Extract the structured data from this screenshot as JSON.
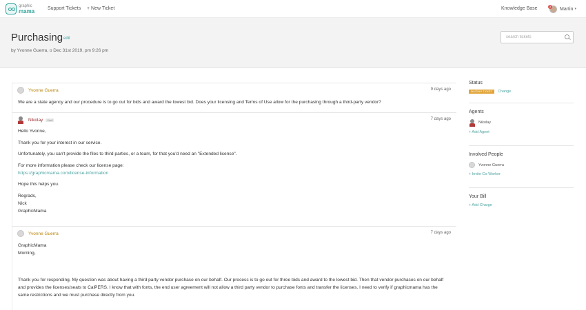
{
  "logo": {
    "line1": "graphic",
    "line2": "mama"
  },
  "nav": {
    "support_tickets": "Support Tickets",
    "new_ticket": "+ New Ticket",
    "knowledge_base": "Knowledge Base",
    "user_name": "Martin",
    "notification_count": "3"
  },
  "header": {
    "title": "Purchasing",
    "edit_label": "edit",
    "byline": "by Yvonne Guerra, o Dec 31st 2019, pm 9:26 pm",
    "search_placeholder": "search tickets"
  },
  "messages": [
    {
      "author": "Yvonne Guerra",
      "time": "9 days ago",
      "body": [
        "We are a state agency and our procedure is to go out for bids and award the lowest bid. Does your licensing and Terms of Use allow for the purchasing through a third-party vendor?"
      ]
    },
    {
      "author": "Nikolay",
      "staff_tag": "Staff",
      "time": "7 days ago",
      "greeting": "Hello Yvonne,",
      "p1": "Thank you for your interest in our service.",
      "p2": "Unfortunately, you can't provide the files to third parties, or a team, for that you'd need an \"Extended license\".",
      "p3": "For more information please check our license page:",
      "link": "https://graphicmama.com/license-information",
      "p4": "Hope this helps you.",
      "sign1": "Regrads,",
      "sign2": "Nick",
      "sign3": "GraphicMama"
    },
    {
      "author": "Yvonne Guerra",
      "time": "7 days ago",
      "line1": "GraphicMama",
      "line2": "Morning,",
      "p1": "Thank you for responding. My question was about having a third party vendor purchase on our behalf. Our process is to go out for three bids and award to the lowest bid. Then that vendor purchases on our behalf and provides the licenses/seats to CalPERS. I know that with fonts, the end user agreement will not allow a third party vendor to purchase fonts and transfer the licenses. I need to verify if graphicmama has the same restrictions and we must purchase directly from you."
    }
  ],
  "sidebar": {
    "status_title": "Status",
    "status_badge": "WAITING TICKET",
    "status_change": "Change",
    "agents_title": "Agents",
    "agent_name": "Nikolay",
    "add_agent": "+ Add Agent",
    "involved_title": "Involved People",
    "involved_name": "Yvonne Guerra",
    "invite": "+ Invite Co-Worker",
    "bill_title": "Your Bill",
    "add_charge": "+ Add Charge"
  },
  "colors": {
    "accent": "#4aa3a0",
    "client_name": "#b8860b",
    "staff_name": "#9b2d30",
    "status_badge": "#e0a53a"
  }
}
